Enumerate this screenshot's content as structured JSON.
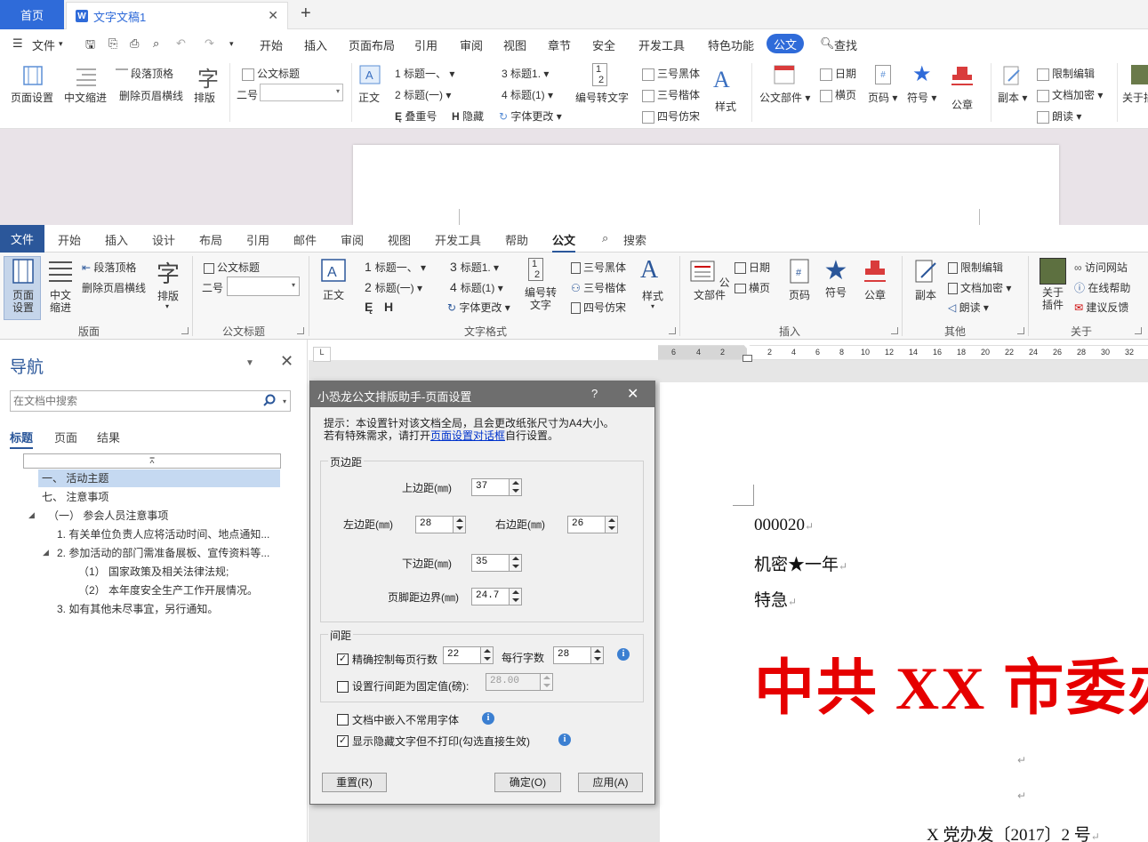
{
  "wps": {
    "home_tab": "首页",
    "doc_tab": "文字文稿1",
    "new_tab": "+",
    "file_menu": "文件",
    "menu": [
      "开始",
      "插入",
      "页面布局",
      "引用",
      "审阅",
      "视图",
      "章节",
      "安全",
      "开发工具",
      "特色功能",
      "公文"
    ],
    "find": "查找",
    "ribbon": {
      "page_setup": "页面设置",
      "cn_indent": "中文缩进",
      "para_top": "段落顶格",
      "del_header_line": "删除页眉横线",
      "typeset_icon": "字",
      "typeset": "排版",
      "doc_title": "公文标题",
      "size_label": "二号",
      "body": "正文",
      "h1": "标题一、",
      "h2": "标题(一)",
      "h3": "标题1.",
      "h4": "标题(1)",
      "overlap": "叠重号",
      "hide": "隐藏",
      "font_change": "字体更改",
      "num_to_text": "编号转文字",
      "heiti": "三号黑体",
      "kaiti": "三号楷体",
      "fangsong": "四号仿宋",
      "style": "样式",
      "doc_parts": "公文部件",
      "date": "日期",
      "landscape": "横页",
      "page_num": "页码",
      "symbol": "符号",
      "seal": "公章",
      "copy": "副本",
      "restrict": "限制编辑",
      "encrypt": "文档加密",
      "read": "朗读",
      "about": "关于插"
    }
  },
  "word": {
    "file": "文件",
    "tabs": [
      "开始",
      "插入",
      "设计",
      "布局",
      "引用",
      "邮件",
      "审阅",
      "视图",
      "开发工具",
      "帮助",
      "公文"
    ],
    "search": "搜索",
    "ribbon": {
      "page_setup": "页面设置",
      "cn_indent": "中文缩进",
      "para_top": "段落顶格",
      "del_header_line": "删除页眉横线",
      "typeset_icon": "字",
      "typeset": "排版",
      "group_layout": "版面",
      "doc_title": "公文标题",
      "size_label": "二号",
      "group_title": "公文标题",
      "body": "正文",
      "h1": "标题一、",
      "h2": "标题(一)",
      "h3": "标题1.",
      "h4": "标题(1)",
      "font_change": "字体更改",
      "num_to_text": "编号转文字",
      "heiti": "三号黑体",
      "kaiti": "三号楷体",
      "fangsong": "四号仿宋",
      "style": "样式",
      "group_text": "文字格式",
      "doc_parts": "公文部件",
      "date": "日期",
      "landscape": "横页",
      "page_num": "页码",
      "symbol": "符号",
      "seal": "公章",
      "group_insert": "插入",
      "copy": "副本",
      "restrict": "限制编辑",
      "encrypt": "文档加密",
      "read": "朗读",
      "group_other": "其他",
      "about": "关于插件",
      "visit": "访问网站",
      "help": "在线帮助",
      "feedback": "建议反馈",
      "group_about": "关于"
    }
  },
  "nav": {
    "title": "导航",
    "search_placeholder": "在文档中搜索",
    "tabs": [
      "标题",
      "页面",
      "结果"
    ],
    "items": [
      "一、 活动主题",
      "七、 注意事项",
      "（一） 参会人员注意事项",
      "1. 有关单位负责人应将活动时间、地点通知...",
      "2. 参加活动的部门需准备展板、宣传资料等...",
      "（1） 国家政策及相关法律法规;",
      "（2） 本年度安全生产工作开展情况。",
      "3. 如有其他未尽事宜，另行通知。"
    ]
  },
  "ruler": {
    "corner": "L",
    "numbers": [
      "6",
      "4",
      "2",
      "2",
      "4",
      "6",
      "8",
      "10",
      "12",
      "14",
      "16",
      "18",
      "20",
      "22",
      "24",
      "26",
      "28",
      "30",
      "32"
    ]
  },
  "document": {
    "line1": "000020",
    "line2": "机密★一年",
    "line3": "特急",
    "headline": "中共 XX 市委办公室",
    "docnum": "X 党办发〔2017〕2 号",
    "para_mark": "↵",
    "headline_color": "#e60000"
  },
  "dialog": {
    "title": "小恐龙公文排版助手-页面设置",
    "help": "?",
    "close": "✕",
    "tip1": "提示：本设置针对该文档全局，且会更改纸张尺寸为A4大小。",
    "tip2_pre": "若有特殊需求，请打开",
    "tip2_link": "页面设置对话框",
    "tip2_post": "自行设置。",
    "margins_legend": "页边距",
    "top_label": "上边距(㎜)",
    "top_value": "37",
    "left_label": "左边距(㎜)",
    "left_value": "28",
    "right_label": "右边距(㎜)",
    "right_value": "26",
    "bottom_label": "下边距(㎜)",
    "bottom_value": "35",
    "footer_label": "页脚距边界(㎜)",
    "footer_value": "24.7",
    "spacing_legend": "间距",
    "lines_label": "精确控制每页行数",
    "lines_value": "22",
    "chars_label": "每行字数",
    "chars_value": "28",
    "fixed_label": "设置行间距为固定值(磅):",
    "fixed_value": "28.00",
    "embed_label": "文档中嵌入不常用字体",
    "hidden_label": "显示隐藏文字但不打印(勾选直接生效)",
    "check_mark": "✓",
    "info": "i",
    "reset": "重置(R)",
    "ok": "确定(O)",
    "apply": "应用(A)"
  },
  "colors": {
    "wps_blue": "#2f6bd9",
    "word_blue": "#2b579a",
    "red": "#e60000"
  }
}
